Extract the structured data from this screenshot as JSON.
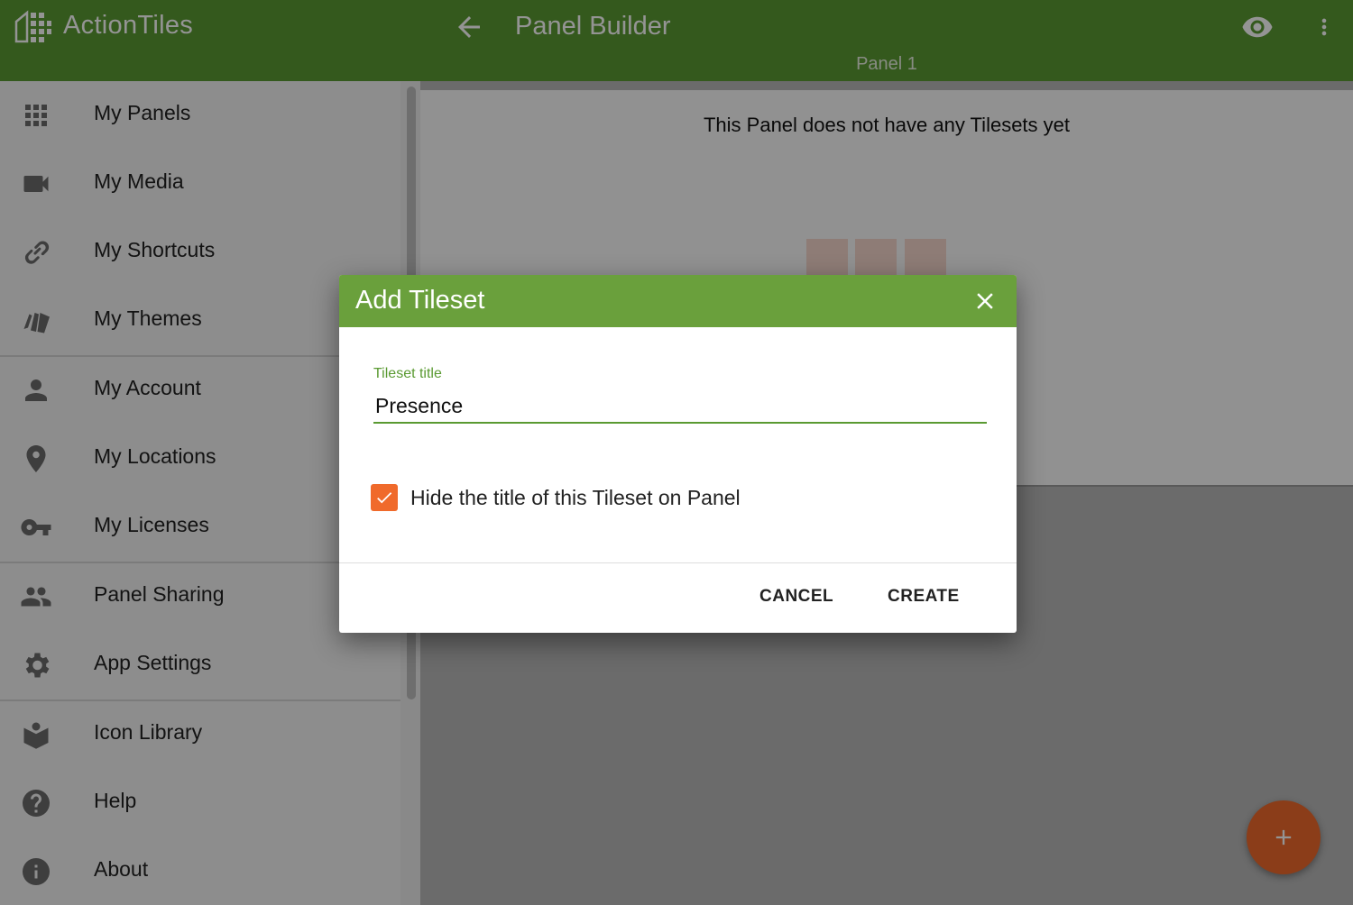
{
  "app": {
    "brand": "ActionTiles"
  },
  "header": {
    "title": "Panel Builder",
    "subtitle": "Panel 1"
  },
  "sidebar": {
    "items": [
      {
        "label": "My Panels",
        "icon": "grid-icon"
      },
      {
        "label": "My Media",
        "icon": "videocam-icon"
      },
      {
        "label": "My Shortcuts",
        "icon": "link-icon"
      },
      {
        "label": "My Themes",
        "icon": "themes-icon"
      },
      {
        "label": "My Account",
        "icon": "person-icon"
      },
      {
        "label": "My Locations",
        "icon": "location-pin-icon"
      },
      {
        "label": "My Licenses",
        "icon": "key-icon"
      },
      {
        "label": "Panel Sharing",
        "icon": "people-icon"
      },
      {
        "label": "App Settings",
        "icon": "gear-icon"
      },
      {
        "label": "Icon Library",
        "icon": "book-icon"
      },
      {
        "label": "Help",
        "icon": "help-icon"
      },
      {
        "label": "About",
        "icon": "info-icon"
      }
    ]
  },
  "main": {
    "empty_message": "This Panel does not have any Tilesets yet"
  },
  "dialog": {
    "title": "Add Tileset",
    "field_label": "Tileset title",
    "field_value": "Presence",
    "checkbox_label": "Hide the title of this Tileset on Panel",
    "checkbox_checked": true,
    "cancel_label": "CANCEL",
    "create_label": "CREATE"
  },
  "colors": {
    "primary": "#5a9a32",
    "dialog_header": "#6aa03c",
    "accent": "#f06a2b"
  }
}
